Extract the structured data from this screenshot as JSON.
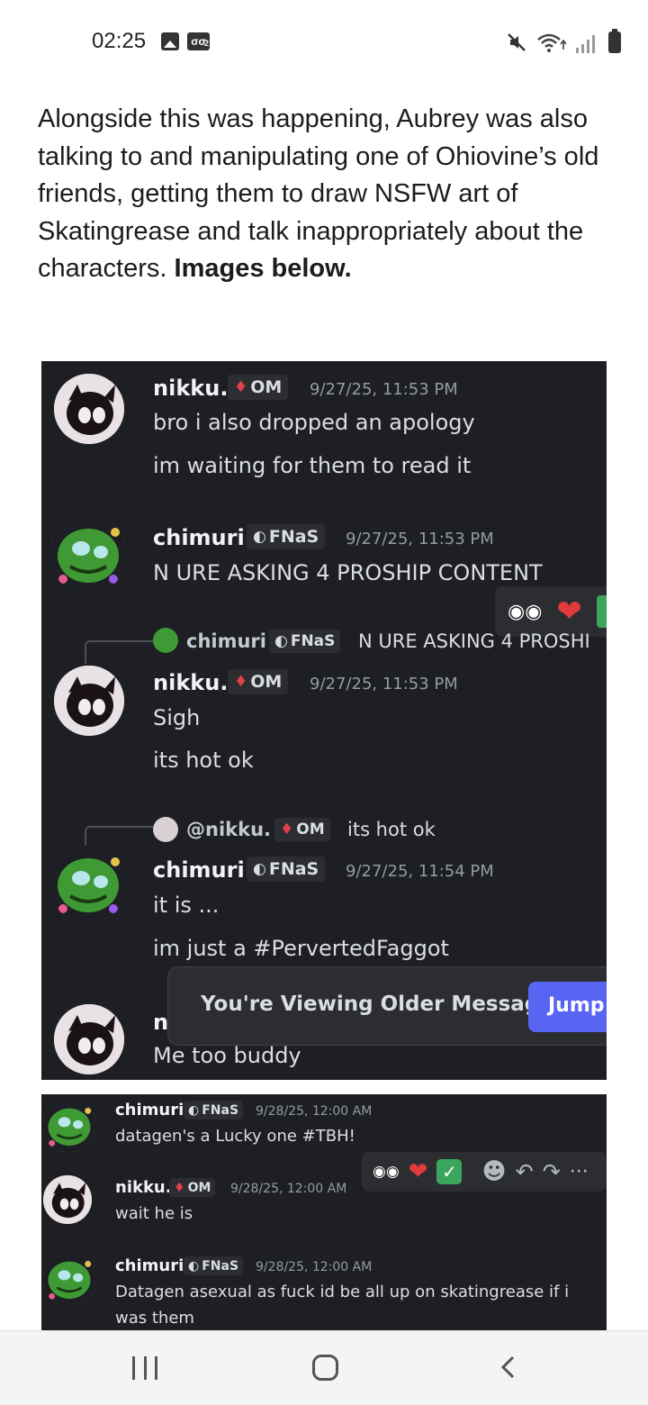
{
  "status_bar": {
    "time": "02:25",
    "voicemail_badge": "2"
  },
  "article": {
    "paragraph": "Alongside this was happening, Aubrey was also talking to and manipulating one of Ohiovine’s old friends, getting them to draw NSFW art of Skatingrease and talk inappropriately about the characters.",
    "bold_suffix": "Images below."
  },
  "screenshot1": {
    "messages": [
      {
        "name": "nikku.",
        "tag": "OM",
        "timestamp": "9/27/25, 11:53 PM",
        "lines": [
          "bro i also dropped an apology",
          "im waiting for them to read it"
        ]
      },
      {
        "name": "chimuri",
        "tag": "FNaS",
        "timestamp": "9/27/25, 11:53 PM",
        "lines": [
          "N URE ASKING 4 PROSHIP CONTENT"
        ]
      },
      {
        "reply_name": "chimuri",
        "reply_tag": "FNaS",
        "reply_text": "N URE ASKING 4 PROSHI",
        "name": "nikku.",
        "tag": "OM",
        "timestamp": "9/27/25, 11:53 PM",
        "lines": [
          "Sigh",
          "its hot ok"
        ]
      },
      {
        "reply_name": "@nikku.",
        "reply_tag": "OM",
        "reply_text": "its hot ok",
        "name": "chimuri",
        "tag": "FNaS",
        "timestamp": "9/27/25, 11:54 PM",
        "lines": [
          "it is ...",
          "im just a #PervertedFaggot"
        ]
      },
      {
        "name_partial": "n",
        "lines": [
          "Me too buddy"
        ]
      }
    ],
    "older_messages_text": "You're Viewing Older Messages",
    "jump_label": "Jump"
  },
  "screenshot2": {
    "messages": [
      {
        "name": "chimuri",
        "tag": "FNaS",
        "timestamp": "9/28/25, 12:00 AM",
        "lines": [
          "datagen's a Lucky one #TBH!"
        ]
      },
      {
        "name": "nikku.",
        "tag": "OM",
        "timestamp": "9/28/25, 12:00 AM",
        "lines": [
          "wait he is"
        ]
      },
      {
        "name": "chimuri",
        "tag": "FNaS",
        "timestamp": "9/28/25, 12:00 AM",
        "lines": [
          "Datagen asexual as fuck id be all up on skatingrease if i",
          "was them"
        ]
      }
    ],
    "more_label": "···"
  },
  "colors": {
    "discord_bg": "#1e1f24",
    "jump_button": "#5865f2",
    "om_gem": "#e0404a",
    "heart": "#e03c3c",
    "check": "#3ba55d"
  },
  "icons": [
    "image-icon",
    "voicemail-icon",
    "mute-icon",
    "wifi-icon",
    "signal-icon",
    "battery-icon",
    "gem-icon",
    "fnas-moon-icon",
    "eyes-icon",
    "heart-icon",
    "check-icon",
    "emoji-icon",
    "reply-icon",
    "forward-icon",
    "more-icon",
    "recent-apps-icon",
    "home-icon",
    "back-icon"
  ]
}
